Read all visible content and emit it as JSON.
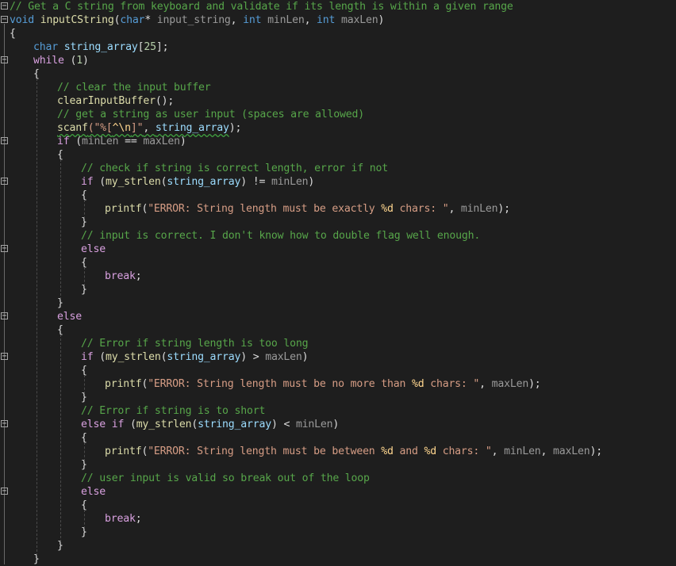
{
  "theme": {
    "background": "#1e1e1e",
    "comment": "#57a64a",
    "keyword": "#569cd6",
    "control": "#d8a0df",
    "function": "#dcdcaa",
    "string": "#d69d85"
  },
  "lines": [
    {
      "indent": 0,
      "fold": "minus",
      "tokens": [
        {
          "t": "// Get a C string from keyboard and validate if its length is within a given range",
          "c": "comment"
        }
      ]
    },
    {
      "indent": 0,
      "fold": "minus",
      "tokens": [
        {
          "t": "void",
          "c": "kw"
        },
        {
          "t": " ",
          "c": "plain"
        },
        {
          "t": "inputCString",
          "c": "fn"
        },
        {
          "t": "(",
          "c": "plain"
        },
        {
          "t": "char",
          "c": "kw"
        },
        {
          "t": "* ",
          "c": "plain"
        },
        {
          "t": "input_string",
          "c": "param"
        },
        {
          "t": ", ",
          "c": "plain"
        },
        {
          "t": "int",
          "c": "kw"
        },
        {
          "t": " ",
          "c": "plain"
        },
        {
          "t": "minLen",
          "c": "param"
        },
        {
          "t": ", ",
          "c": "plain"
        },
        {
          "t": "int",
          "c": "kw"
        },
        {
          "t": " ",
          "c": "plain"
        },
        {
          "t": "maxLen",
          "c": "param"
        },
        {
          "t": ")",
          "c": "plain"
        }
      ]
    },
    {
      "indent": 0,
      "fold": "",
      "tokens": [
        {
          "t": "{",
          "c": "plain"
        }
      ]
    },
    {
      "indent": 1,
      "fold": "",
      "tokens": [
        {
          "t": "char",
          "c": "kw"
        },
        {
          "t": " ",
          "c": "plain"
        },
        {
          "t": "string_array",
          "c": "var"
        },
        {
          "t": "[",
          "c": "plain"
        },
        {
          "t": "25",
          "c": "num"
        },
        {
          "t": "];",
          "c": "plain"
        }
      ]
    },
    {
      "indent": 1,
      "fold": "minus",
      "tokens": [
        {
          "t": "while",
          "c": "ctrl"
        },
        {
          "t": " (",
          "c": "plain"
        },
        {
          "t": "1",
          "c": "num"
        },
        {
          "t": ")",
          "c": "plain"
        }
      ]
    },
    {
      "indent": 1,
      "fold": "",
      "tokens": [
        {
          "t": "{",
          "c": "plain"
        }
      ]
    },
    {
      "indent": 2,
      "fold": "",
      "tokens": [
        {
          "t": "// clear the input buffer",
          "c": "comment"
        }
      ]
    },
    {
      "indent": 2,
      "fold": "",
      "tokens": [
        {
          "t": "clearInputBuffer",
          "c": "fn"
        },
        {
          "t": "();",
          "c": "plain"
        }
      ]
    },
    {
      "indent": 2,
      "fold": "",
      "tokens": [
        {
          "t": "// get a string as user input (spaces are allowed)",
          "c": "comment"
        }
      ]
    },
    {
      "indent": 2,
      "fold": "",
      "tokens": [
        {
          "t": "scanf",
          "c": "fn",
          "sq": true
        },
        {
          "t": "(\"%[",
          "c": "str",
          "sq": true
        },
        {
          "t": "^\\n",
          "c": "esc",
          "sq": true
        },
        {
          "t": "]\"",
          "c": "str",
          "sq": true
        },
        {
          "t": ", ",
          "c": "plain",
          "sq": true
        },
        {
          "t": "string_array",
          "c": "var",
          "sq": true
        },
        {
          "t": ");",
          "c": "plain"
        }
      ]
    },
    {
      "indent": 2,
      "fold": "minus",
      "tokens": [
        {
          "t": "if",
          "c": "ctrl"
        },
        {
          "t": " (",
          "c": "plain"
        },
        {
          "t": "minLen",
          "c": "param"
        },
        {
          "t": " == ",
          "c": "plain"
        },
        {
          "t": "maxLen",
          "c": "param"
        },
        {
          "t": ")",
          "c": "plain"
        }
      ]
    },
    {
      "indent": 2,
      "fold": "",
      "tokens": [
        {
          "t": "{",
          "c": "plain"
        }
      ]
    },
    {
      "indent": 3,
      "fold": "",
      "tokens": [
        {
          "t": "// check if string is correct length, error if not",
          "c": "comment"
        }
      ]
    },
    {
      "indent": 3,
      "fold": "minus",
      "tokens": [
        {
          "t": "if",
          "c": "ctrl"
        },
        {
          "t": " (",
          "c": "plain"
        },
        {
          "t": "my_strlen",
          "c": "fn"
        },
        {
          "t": "(",
          "c": "plain"
        },
        {
          "t": "string_array",
          "c": "var"
        },
        {
          "t": ") != ",
          "c": "plain"
        },
        {
          "t": "minLen",
          "c": "param"
        },
        {
          "t": ")",
          "c": "plain"
        }
      ]
    },
    {
      "indent": 3,
      "fold": "",
      "tokens": [
        {
          "t": "{",
          "c": "plain"
        }
      ]
    },
    {
      "indent": 4,
      "fold": "",
      "tokens": [
        {
          "t": "printf",
          "c": "fn"
        },
        {
          "t": "(",
          "c": "plain"
        },
        {
          "t": "\"ERROR: String length must be exactly ",
          "c": "str"
        },
        {
          "t": "%d",
          "c": "esc"
        },
        {
          "t": " chars: \"",
          "c": "str"
        },
        {
          "t": ", ",
          "c": "plain"
        },
        {
          "t": "minLen",
          "c": "param"
        },
        {
          "t": ");",
          "c": "plain"
        }
      ]
    },
    {
      "indent": 3,
      "fold": "",
      "tokens": [
        {
          "t": "}",
          "c": "plain"
        }
      ]
    },
    {
      "indent": 3,
      "fold": "",
      "tokens": [
        {
          "t": "// input is correct. I don't know how to double flag well enough.",
          "c": "comment"
        }
      ]
    },
    {
      "indent": 3,
      "fold": "minus",
      "tokens": [
        {
          "t": "else",
          "c": "ctrl"
        }
      ]
    },
    {
      "indent": 3,
      "fold": "",
      "tokens": [
        {
          "t": "{",
          "c": "plain"
        }
      ]
    },
    {
      "indent": 4,
      "fold": "",
      "tokens": [
        {
          "t": "break",
          "c": "ctrl"
        },
        {
          "t": ";",
          "c": "plain"
        }
      ]
    },
    {
      "indent": 3,
      "fold": "",
      "tokens": [
        {
          "t": "}",
          "c": "plain"
        }
      ]
    },
    {
      "indent": 2,
      "fold": "",
      "tokens": [
        {
          "t": "}",
          "c": "plain"
        }
      ]
    },
    {
      "indent": 2,
      "fold": "minus",
      "tokens": [
        {
          "t": "else",
          "c": "ctrl"
        }
      ]
    },
    {
      "indent": 2,
      "fold": "",
      "tokens": [
        {
          "t": "{",
          "c": "plain"
        }
      ]
    },
    {
      "indent": 3,
      "fold": "",
      "tokens": [
        {
          "t": "// Error if string length is too long",
          "c": "comment"
        }
      ]
    },
    {
      "indent": 3,
      "fold": "minus",
      "tokens": [
        {
          "t": "if",
          "c": "ctrl"
        },
        {
          "t": " (",
          "c": "plain"
        },
        {
          "t": "my_strlen",
          "c": "fn"
        },
        {
          "t": "(",
          "c": "plain"
        },
        {
          "t": "string_array",
          "c": "var"
        },
        {
          "t": ") > ",
          "c": "plain"
        },
        {
          "t": "maxLen",
          "c": "param"
        },
        {
          "t": ")",
          "c": "plain"
        }
      ]
    },
    {
      "indent": 3,
      "fold": "",
      "tokens": [
        {
          "t": "{",
          "c": "plain"
        }
      ]
    },
    {
      "indent": 4,
      "fold": "",
      "tokens": [
        {
          "t": "printf",
          "c": "fn"
        },
        {
          "t": "(",
          "c": "plain"
        },
        {
          "t": "\"ERROR: String length must be no more than ",
          "c": "str"
        },
        {
          "t": "%d",
          "c": "esc"
        },
        {
          "t": " chars: \"",
          "c": "str"
        },
        {
          "t": ", ",
          "c": "plain"
        },
        {
          "t": "maxLen",
          "c": "param"
        },
        {
          "t": ");",
          "c": "plain"
        }
      ]
    },
    {
      "indent": 3,
      "fold": "",
      "tokens": [
        {
          "t": "}",
          "c": "plain"
        }
      ]
    },
    {
      "indent": 3,
      "fold": "",
      "tokens": [
        {
          "t": "// Error if string is to short",
          "c": "comment"
        }
      ]
    },
    {
      "indent": 3,
      "fold": "minus",
      "tokens": [
        {
          "t": "else",
          "c": "ctrl"
        },
        {
          "t": " ",
          "c": "plain"
        },
        {
          "t": "if",
          "c": "ctrl"
        },
        {
          "t": " (",
          "c": "plain"
        },
        {
          "t": "my_strlen",
          "c": "fn"
        },
        {
          "t": "(",
          "c": "plain"
        },
        {
          "t": "string_array",
          "c": "var"
        },
        {
          "t": ") < ",
          "c": "plain"
        },
        {
          "t": "minLen",
          "c": "param"
        },
        {
          "t": ")",
          "c": "plain"
        }
      ]
    },
    {
      "indent": 3,
      "fold": "",
      "tokens": [
        {
          "t": "{",
          "c": "plain"
        }
      ]
    },
    {
      "indent": 4,
      "fold": "",
      "tokens": [
        {
          "t": "printf",
          "c": "fn"
        },
        {
          "t": "(",
          "c": "plain"
        },
        {
          "t": "\"ERROR: String length must be between ",
          "c": "str"
        },
        {
          "t": "%d",
          "c": "esc"
        },
        {
          "t": " and ",
          "c": "str"
        },
        {
          "t": "%d",
          "c": "esc"
        },
        {
          "t": " chars: \"",
          "c": "str"
        },
        {
          "t": ", ",
          "c": "plain"
        },
        {
          "t": "minLen",
          "c": "param"
        },
        {
          "t": ", ",
          "c": "plain"
        },
        {
          "t": "maxLen",
          "c": "param"
        },
        {
          "t": ");",
          "c": "plain"
        }
      ]
    },
    {
      "indent": 3,
      "fold": "",
      "tokens": [
        {
          "t": "}",
          "c": "plain"
        }
      ]
    },
    {
      "indent": 3,
      "fold": "",
      "tokens": [
        {
          "t": "// user input is valid so break out of the loop",
          "c": "comment"
        }
      ]
    },
    {
      "indent": 3,
      "fold": "minus",
      "tokens": [
        {
          "t": "else",
          "c": "ctrl"
        }
      ]
    },
    {
      "indent": 3,
      "fold": "",
      "tokens": [
        {
          "t": "{",
          "c": "plain"
        }
      ]
    },
    {
      "indent": 4,
      "fold": "",
      "tokens": [
        {
          "t": "break",
          "c": "ctrl"
        },
        {
          "t": ";",
          "c": "plain"
        }
      ]
    },
    {
      "indent": 3,
      "fold": "",
      "tokens": [
        {
          "t": "}",
          "c": "plain"
        }
      ]
    },
    {
      "indent": 2,
      "fold": "",
      "tokens": [
        {
          "t": "}",
          "c": "plain"
        }
      ]
    },
    {
      "indent": 1,
      "fold": "",
      "tokens": [
        {
          "t": "}",
          "c": "plain"
        }
      ]
    }
  ]
}
